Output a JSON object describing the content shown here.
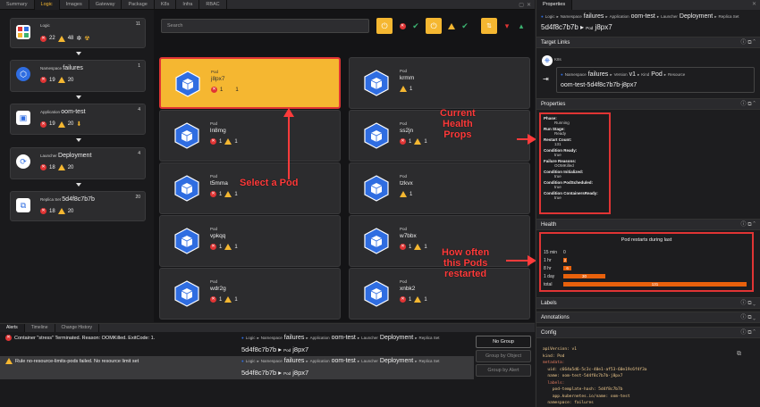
{
  "top_tabs": [
    "Summary",
    "Logic",
    "Images",
    "Gateway",
    "Package",
    "K8s",
    "Infra",
    "RBAC"
  ],
  "active_tab": "Logic",
  "hierarchy": [
    {
      "kind": "Logic",
      "name": "",
      "count": "11",
      "errors": "22",
      "warnings": "48"
    },
    {
      "kind": "Namespace",
      "name": "failures",
      "count": "1",
      "errors": "19",
      "warnings": "20"
    },
    {
      "kind": "Application",
      "name": "oom-test",
      "count": "4",
      "errors": "19",
      "warnings": "20"
    },
    {
      "kind": "Launcher",
      "name": "Deployment",
      "count": "4",
      "errors": "18",
      "warnings": "20"
    },
    {
      "kind": "Replica Set",
      "name": "5d4f8c7b7b",
      "count": "20",
      "errors": "18",
      "warnings": "20"
    }
  ],
  "search": {
    "placeholder": "Search"
  },
  "pods": [
    {
      "kind": "Pod",
      "name": "j8px7",
      "errors": "1",
      "warnings": "1"
    },
    {
      "kind": "Pod",
      "name": "krmm",
      "errors": "",
      "warnings": "1"
    },
    {
      "kind": "Pod",
      "name": "ln8mg",
      "errors": "1",
      "warnings": "1"
    },
    {
      "kind": "Pod",
      "name": "ss2jn",
      "errors": "1",
      "warnings": "1"
    },
    {
      "kind": "Pod",
      "name": "t5mma",
      "errors": "1",
      "warnings": "1"
    },
    {
      "kind": "Pod",
      "name": "tzkvx",
      "errors": "",
      "warnings": "1"
    },
    {
      "kind": "Pod",
      "name": "vpkqq",
      "errors": "1",
      "warnings": "1"
    },
    {
      "kind": "Pod",
      "name": "w7bbx",
      "errors": "1",
      "warnings": "1"
    },
    {
      "kind": "Pod",
      "name": "wdr2g",
      "errors": "1",
      "warnings": "1"
    },
    {
      "kind": "Pod",
      "name": "xnbk2",
      "errors": "1",
      "warnings": "1"
    }
  ],
  "annotations": {
    "select_pod": "Select a Pod",
    "current_health_1": "Current",
    "current_health_2": "Health",
    "current_health_3": "Props",
    "how_often_1": "How often",
    "how_often_2": "this Pods",
    "how_often_3": "restarted"
  },
  "alert_tabs": [
    "Alerts",
    "Timeline",
    "Change History"
  ],
  "alerts": [
    {
      "message": "Container \"stress\" Terminated. Reason: OOMKilled. ExitCode: 1.",
      "level": "error"
    },
    {
      "message": "Rule no-resource-limits-pods failed. No resource limit set",
      "level": "warning"
    }
  ],
  "alert_ctx": {
    "logic": "Logic",
    "ns_label": "Namespace",
    "ns": "failures",
    "app_label": "Application",
    "app": "oom-test",
    "launcher_label": "Launcher",
    "launcher": "Deployment",
    "rs_label": "Replica Set",
    "rs": "5d4f8c7b7b",
    "pod_label": "Pod",
    "pod": "j8px7"
  },
  "group_buttons": [
    "No Group",
    "Group by Object",
    "Group by Alert"
  ],
  "properties_panel": {
    "tab": "Properties",
    "bc_logic": "Logic",
    "bc_ns_label": "Namespace",
    "bc_ns": "failures",
    "bc_app_label": "Application",
    "bc_app": "oom-test",
    "bc_launcher_label": "Launcher",
    "bc_launcher": "Deployment",
    "bc_rs_label": "Replica Set",
    "title_rs": "5d4f8c7b7b",
    "title_pod_label": "Pod",
    "title_pod": "j8px7",
    "target_links": "Target Links",
    "k8s": "K8s",
    "tl_ns_label": "Namespace",
    "tl_ns": "failures",
    "tl_ver_label": "Version",
    "tl_ver": "v1",
    "tl_kind_label": "Kind",
    "tl_kind": "Pod",
    "tl_res_label": "Resource",
    "tl_name": "oom-test-5d4f8c7b7b-j8px7",
    "properties": "Properties",
    "health": "Health",
    "labels": "Labels",
    "annotations": "Annotations",
    "config": "Config"
  },
  "props": [
    {
      "k": "Phase:",
      "v": "Running"
    },
    {
      "k": "Run Stage:",
      "v": "Ready"
    },
    {
      "k": "Restart Count:",
      "v": "131"
    },
    {
      "k": "Condition Ready:",
      "v": "true"
    },
    {
      "k": "Failure Reasons:",
      "v": "OOMKilled"
    },
    {
      "k": "Condition Initialized:",
      "v": "true"
    },
    {
      "k": "Condition PodScheduled:",
      "v": "true"
    },
    {
      "k": "Condition ContainersReady:",
      "v": "true"
    }
  ],
  "chart_data": {
    "type": "bar",
    "title": "Pod restarts during last",
    "categories": [
      "15 min",
      "1 hr",
      "8 hr",
      "1 day",
      "total"
    ],
    "values": [
      0,
      2,
      6,
      30,
      131
    ],
    "labels": [
      "0",
      "2",
      "6",
      "30",
      "131"
    ],
    "xlim": [
      0,
      131
    ]
  },
  "config_lines": [
    "apiVersion: v1",
    "kind: Pod",
    "metadata:",
    "  uid: c664a5d6-5c3c-40e1-af53-60e19c6f4f3a",
    "  name: oom-test-5d4f8c7b7b-j8px7",
    "  labels:",
    "    pod-template-hash: 5d4f8c7b7b",
    "    app.kubernetes.io/name: oom-test",
    "  namespace: failures"
  ],
  "colors": {
    "accent": "#f5b731",
    "error": "#e03434",
    "bar": "#e8610c",
    "pod_blue": "#2f6de1"
  }
}
